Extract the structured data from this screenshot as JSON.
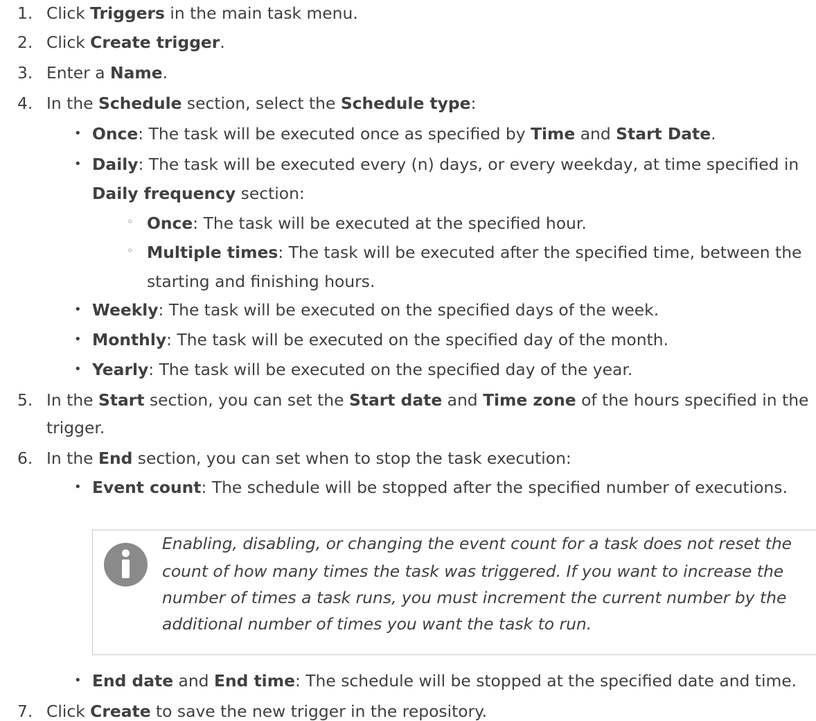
{
  "steps": {
    "s1": {
      "num": "1.",
      "t1": "Click ",
      "b1": "Triggers",
      "t2": " in the main task menu."
    },
    "s2": {
      "num": "2.",
      "t1": "Click ",
      "b1": "Create trigger",
      "t2": "."
    },
    "s3": {
      "num": "3.",
      "t1": "Enter a ",
      "b1": "Name",
      "t2": "."
    },
    "s4": {
      "num": "4.",
      "t1": "In the ",
      "b1": "Schedule",
      "t2": " section, select the ",
      "b2": "Schedule type",
      "t3": ":",
      "once": {
        "b1": "Once",
        "t1": ": The task will be executed once as specified by ",
        "b2": "Time",
        "t2": " and ",
        "b3": "Start Date",
        "t3": "."
      },
      "daily": {
        "b1": "Daily",
        "t1": ": The task will be executed every (n) days, or every weekday, at time specified in",
        "b2": "Daily frequency",
        "t2": " section:",
        "sub_once": {
          "b1": "Once",
          "t1": ": The task will be executed at the specified hour."
        },
        "sub_multi": {
          "b1": "Multiple times",
          "t1": ": The task will be executed after the specified time, between the",
          "t2": "starting and finishing hours."
        }
      },
      "weekly": {
        "b1": "Weekly",
        "t1": ": The task will be executed on the specified days of the week."
      },
      "monthly": {
        "b1": "Monthly",
        "t1": ": The task will be executed on the specified day of the month."
      },
      "yearly": {
        "b1": "Yearly",
        "t1": ": The task will be executed on the specified day of the year."
      }
    },
    "s5": {
      "num": "5.",
      "t1": "In the ",
      "b1": "Start",
      "t2": " section, you can set the ",
      "b2": "Start date",
      "t3": " and ",
      "b3": "Time zone",
      "t4": " of the hours specified in the",
      "t5": "trigger."
    },
    "s6": {
      "num": "6.",
      "t1": "In the ",
      "b1": "End",
      "t2": " section, you can set when to stop the task execution:",
      "event": {
        "b1": "Event count",
        "t1": ": The schedule will be stopped after the specified number of executions."
      },
      "note": {
        "l1": "Enabling, disabling, or changing the event count for a task does not reset the",
        "l2": "count of how many times the task was triggered. If you want to increase the",
        "l3": "number of times a task runs, you must increment the current number by the",
        "l4": "additional number of times you want the task to run."
      },
      "enddate": {
        "b1": "End date",
        "t1": " and ",
        "b2": "End time",
        "t2": ": The schedule will be stopped at the specified date and time."
      }
    },
    "s7": {
      "num": "7.",
      "t1": "Click ",
      "b1": "Create",
      "t2": " to save the new trigger in the repository."
    }
  },
  "bullet": "•",
  "sub_bullet": "◦",
  "icon": {
    "name": "info-icon",
    "color": "#8a8a8a"
  }
}
